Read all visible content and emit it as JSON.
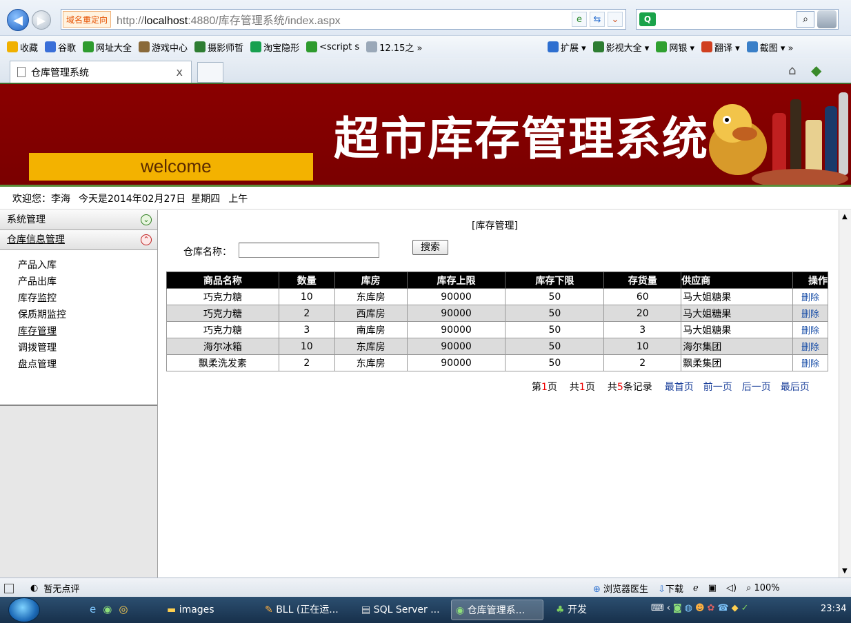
{
  "browser": {
    "redirect_tag": "域名重定向",
    "url_prefix": "http://",
    "url_host": "localhost",
    "url_rest": ":4880/库存管理系统/index.aspx",
    "search_engine_icon": "Q",
    "favorites": [
      {
        "label": "收藏",
        "icon": "star-icon",
        "color": "#f0b000"
      },
      {
        "label": "谷歌",
        "icon": "google-icon",
        "color": "#3a6fd8"
      },
      {
        "label": "网址大全",
        "icon": "globe-icon",
        "color": "#2e9b2e"
      },
      {
        "label": "游戏中心",
        "icon": "game-icon",
        "color": "#8a6a3a"
      },
      {
        "label": "摄影师哲",
        "icon": "douban-icon",
        "color": "#2e7d32"
      },
      {
        "label": "淘宝隐形",
        "icon": "search-icon",
        "color": "#18a050"
      },
      {
        "label": "<script s",
        "icon": "globe-icon",
        "color": "#2e9b2e"
      },
      {
        "label": "12.15之 »",
        "icon": "page-icon",
        "color": "#9aa8b8"
      }
    ],
    "right_tools": [
      {
        "label": "扩展 ▾",
        "color": "#2e6fd0"
      },
      {
        "label": "影视大全 ▾",
        "color": "#2e7d32"
      },
      {
        "label": "网银 ▾",
        "color": "#30a030"
      },
      {
        "label": "翻译 ▾",
        "color": "#d04020"
      },
      {
        "label": "截图 ▾ »",
        "color": "#3a7fc8"
      }
    ],
    "tab_title": "仓库管理系统",
    "tab_close": "x"
  },
  "banner": {
    "welcome": "welcome",
    "title": "超市库存管理系统"
  },
  "greeting": {
    "user": "欢迎您：李海",
    "date": "今天是2014年02月27日",
    "weekday": "星期四",
    "period": "上午"
  },
  "sidebar": {
    "sections": [
      {
        "label": "系统管理",
        "state": "collapsed"
      },
      {
        "label": "仓库信息管理",
        "state": "expanded"
      }
    ],
    "items": [
      "产品入库",
      "产品出库",
      "库存监控",
      "保质期监控",
      "库存管理",
      "调拨管理",
      "盘点管理"
    ]
  },
  "main": {
    "caption": "[库存管理]",
    "filter_label": "仓库名称：",
    "filter_value": "",
    "search_button": "搜索",
    "columns": [
      "商品名称",
      "数量",
      "库房",
      "库存上限",
      "库存下限",
      "存货量",
      "供应商",
      "操作"
    ],
    "rows": [
      [
        "巧克力糖",
        "10",
        "东库房",
        "90000",
        "50",
        "60",
        "马大姐糖果",
        "删除"
      ],
      [
        "巧克力糖",
        "2",
        "西库房",
        "90000",
        "50",
        "20",
        "马大姐糖果",
        "删除"
      ],
      [
        "巧克力糖",
        "3",
        "南库房",
        "90000",
        "50",
        "3",
        "马大姐糖果",
        "删除"
      ],
      [
        "海尔冰箱",
        "10",
        "东库房",
        "90000",
        "50",
        "10",
        "海尔集团",
        "删除"
      ],
      [
        "飘柔洗发素",
        "2",
        "东库房",
        "90000",
        "50",
        "2",
        "飘柔集团",
        "删除"
      ]
    ],
    "pager": {
      "page_pre": "第",
      "page_num": "1",
      "page_post": "页",
      "total_pre": "共",
      "total_num": "1",
      "total_post": "页",
      "rec_pre": "共",
      "rec_num": "5",
      "rec_post": "条记录",
      "first": "最首页",
      "prev": "前一页",
      "next": "后一页",
      "last": "最后页"
    }
  },
  "statusbar": {
    "rating": "暂无点评",
    "doctor": "浏览器医生",
    "download": "下载",
    "zoom": "100%"
  },
  "taskbar": {
    "tasks": [
      "images",
      "BLL (正在运...",
      "SQL Server ...",
      "仓库管理系...",
      "开发"
    ],
    "clock": "23:34"
  }
}
